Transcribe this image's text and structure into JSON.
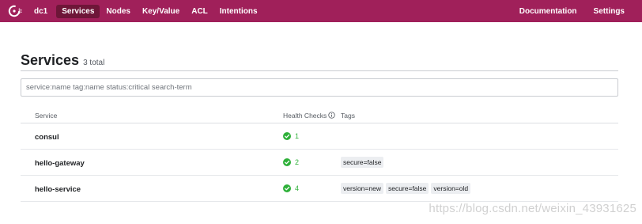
{
  "nav": {
    "datacenter": "dc1",
    "items": [
      {
        "label": "Services",
        "active": true
      },
      {
        "label": "Nodes",
        "active": false
      },
      {
        "label": "Key/Value",
        "active": false
      },
      {
        "label": "ACL",
        "active": false
      },
      {
        "label": "Intentions",
        "active": false
      }
    ],
    "right": [
      {
        "label": "Documentation"
      },
      {
        "label": "Settings"
      }
    ],
    "brand_color": "#a0205a",
    "active_color": "#6e1638"
  },
  "header": {
    "title": "Services",
    "count": "3 total"
  },
  "search": {
    "placeholder": "service:name tag:name status:critical search-term",
    "value": ""
  },
  "table": {
    "columns": [
      "Service",
      "Health Checks",
      "Tags"
    ],
    "rows": [
      {
        "name": "consul",
        "checks": "1",
        "tags": []
      },
      {
        "name": "hello-gateway",
        "checks": "2",
        "tags": [
          "secure=false"
        ]
      },
      {
        "name": "hello-service",
        "checks": "4",
        "tags": [
          "version=new",
          "secure=false",
          "version=old"
        ]
      }
    ],
    "passing_color": "#2eb039"
  },
  "watermark": "https://blog.csdn.net/weixin_43931625"
}
